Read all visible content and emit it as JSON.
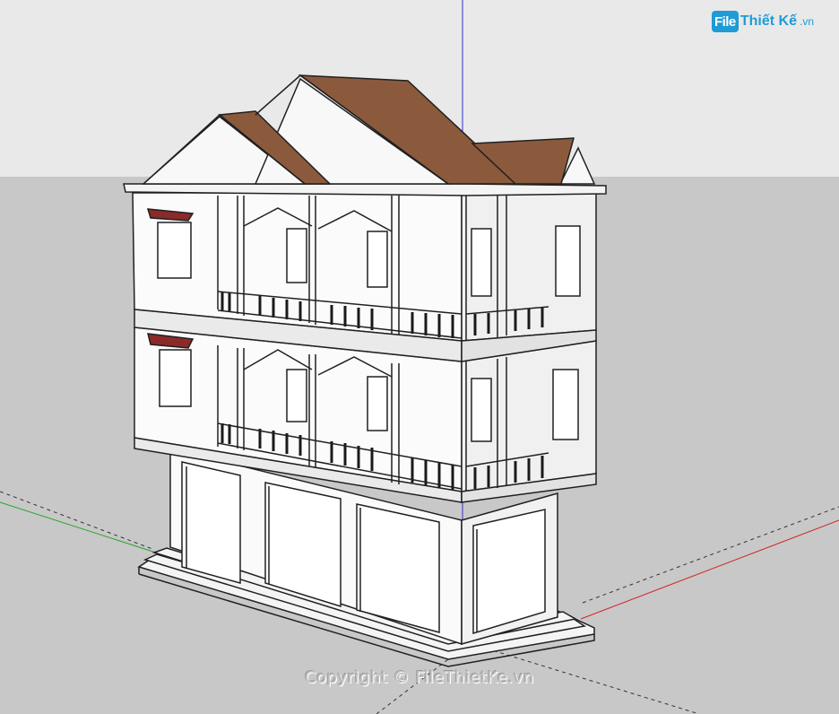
{
  "logo": {
    "badge": "File",
    "name": "Thiết Kế",
    "suffix": ".vn"
  },
  "watermark": {
    "text": "Copyright © FileThietKe.vn"
  },
  "colors": {
    "sky": "#e8e8e8",
    "ground": "#c9c9c9",
    "roof": "#8b5a3c",
    "wall": "#f8f8f8",
    "trim": "#202020",
    "axis_blue": "#3434c8",
    "axis_red": "#d42a2a",
    "axis_green": "#28b428",
    "logo_blue": "#1f9bd6"
  }
}
